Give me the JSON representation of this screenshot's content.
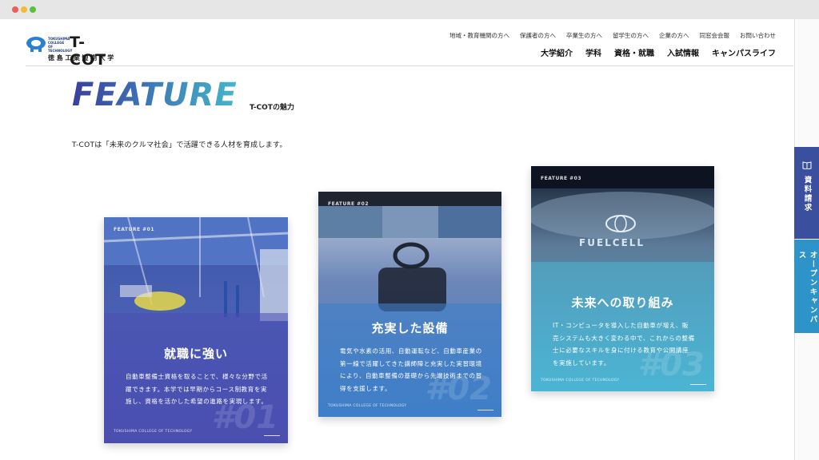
{
  "header": {
    "logo_text": "T-COT",
    "logo_small": "TOKUSHIMA COLLEGE OF TECHNOLOGY",
    "logo_jp": "徳島工業短期大学",
    "subnav": [
      "地域・教育機関の方へ",
      "保護者の方へ",
      "卒業生の方へ",
      "留学生の方へ",
      "企業の方へ",
      "同窓会会報",
      "お問い合わせ"
    ],
    "mainnav": [
      "大学紹介",
      "学科",
      "資格・就職",
      "入試情報",
      "キャンパスライフ"
    ]
  },
  "feature": {
    "title": "FEATURE",
    "subtitle": "T-COTの魅力",
    "lead": "T-COTは「未来のクルマ社会」で活躍できる人材を育成します。"
  },
  "cards": [
    {
      "label": "FEATURE #01",
      "title": "就職に強い",
      "body": "自動車整備士資格を取ることで、様々な分野で活躍できます。本学では早期からコース制教育を実施し、資格を活かした希望の進路を実現します。",
      "number": "#01",
      "footer": "TOKUSHIMA COLLEGE OF TECHNOLOGY"
    },
    {
      "label": "FEATURE #02",
      "title": "充実した設備",
      "body": "電気や水素の活用、自動運転など、自動車産業の第一線で活躍してきた講師陣と充実した実習環境により、自動車整備の基礎から先端技術までの習得を支援します。",
      "number": "#02",
      "footer": "TOKUSHIMA COLLEGE OF TECHNOLOGY"
    },
    {
      "label": "FEATURE #03",
      "title": "未来への取り組み",
      "body": "IT・コンピュータを導入した自動車が増え、販売システムも大きく変わる中で、これからの整備士に必要なスキルを身に付ける教育や公開講座を実施しています。",
      "number": "#03",
      "footer": "TOKUSHIMA COLLEGE OF TECHNOLOGY"
    }
  ],
  "side_tabs": {
    "doc_request": "資料請求",
    "open_campus": "オープンキャンパス"
  },
  "colors": {
    "card1_overlay": "#4a4fb0",
    "card2_overlay": "#3f7fc8",
    "card3_overlay": "#4cb5d4",
    "tab_doc": "#3a4f9e",
    "tab_oc": "#2d93c9"
  }
}
